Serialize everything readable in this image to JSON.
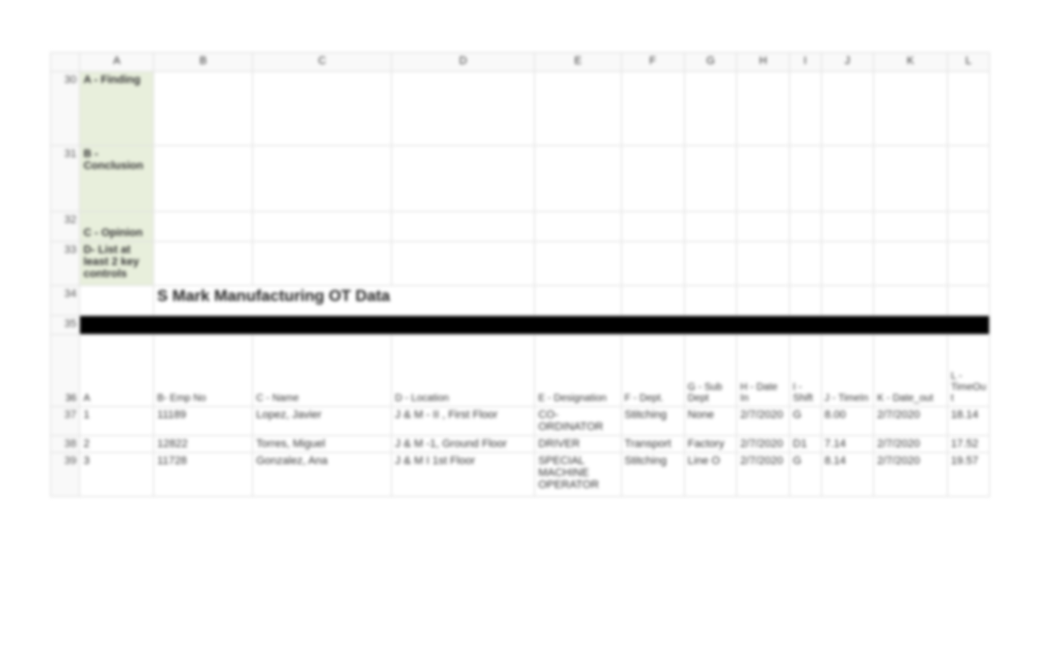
{
  "columns": [
    "A",
    "B",
    "C",
    "D",
    "E",
    "F",
    "G",
    "H",
    "I",
    "J",
    "K",
    "L"
  ],
  "rowNumbers": [
    "30",
    "31",
    "32",
    "33",
    "34",
    "35",
    "36",
    "37",
    "38",
    "39"
  ],
  "side": {
    "r30": "A - Finding",
    "r31": "B - Conclusion",
    "r32": "C - Opinion",
    "r33": "D- List at least 2 key controls"
  },
  "title": "S Mark Manufacturing OT Data",
  "headers": {
    "A": "A",
    "B": "B- Emp No",
    "C": "C - Name",
    "D": "D - Location",
    "E": "E - Designation",
    "F": "F - Dept.",
    "G": "G - Sub Dept",
    "H": "H - Date In",
    "I": "I - Shift",
    "J": "J - TimeIn",
    "K": "K - Date_out",
    "L": "L - TimeOut"
  },
  "data": [
    {
      "A": "1",
      "B": "11189",
      "C": "Lopez, Javier",
      "D": "J & M - II , First Floor",
      "E": "CO-ORDINATOR",
      "F": "Stitching",
      "G": "None",
      "H": "2/7/2020",
      "I": "G",
      "J": "8.00",
      "K": "2/7/2020",
      "L": "18.14"
    },
    {
      "A": "2",
      "B": "12822",
      "C": "Torres, Miguel",
      "D": "J & M -1, Ground Floor",
      "E": "DRIVER",
      "F": "Transport",
      "G": "Factory",
      "H": "2/7/2020",
      "I": "D1",
      "J": "7.14",
      "K": "2/7/2020",
      "L": "17.52"
    },
    {
      "A": "3",
      "B": "11728",
      "C": "Gonzalez, Ana",
      "D": "J & M I 1st Floor",
      "E": "SPECIAL MACHINE OPERATOR",
      "F": "Stitching",
      "G": "Line O",
      "H": "2/7/2020",
      "I": "G",
      "J": "8.14",
      "K": "2/7/2020",
      "L": "19.57"
    }
  ]
}
